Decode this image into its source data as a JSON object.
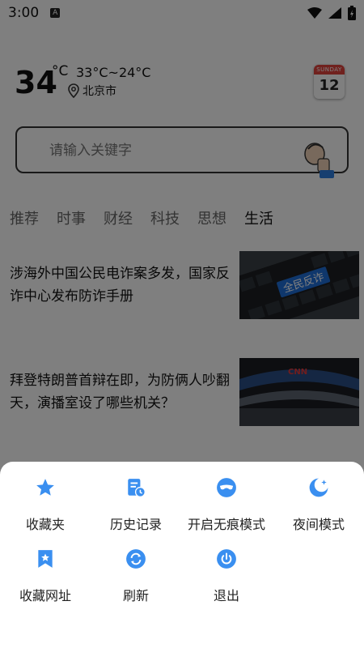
{
  "status_bar": {
    "time": "3:00",
    "badge": "A"
  },
  "weather": {
    "temperature": "34",
    "unit": "°C",
    "range": "33°C~24°C",
    "city": "北京市",
    "calendar_header": "SUNDAY",
    "calendar_day": "12"
  },
  "search": {
    "placeholder": "请输入关键字"
  },
  "tabs": [
    "推荐",
    "时事",
    "财经",
    "科技",
    "思想",
    "生活"
  ],
  "active_tab": "生活",
  "news": [
    {
      "title": "涉海外中国公民电诈案多发，国家反诈中心发布防诈手册",
      "thumb_text": "全民反诈"
    },
    {
      "title": "拜登特朗普首辩在即，为防俩人吵翻天，演播室设了哪些机关？",
      "thumb_text": "CNN"
    }
  ],
  "menu": {
    "accent_color": "#3a8ff0",
    "items": [
      {
        "label": "收藏夹",
        "icon": "star-icon"
      },
      {
        "label": "历史记录",
        "icon": "history-icon"
      },
      {
        "label": "开启无痕模式",
        "icon": "incognito-icon"
      },
      {
        "label": "夜间模式",
        "icon": "moon-icon"
      },
      {
        "label": "收藏网址",
        "icon": "bookmark-icon"
      },
      {
        "label": "刷新",
        "icon": "refresh-icon"
      },
      {
        "label": "退出",
        "icon": "power-icon"
      }
    ]
  }
}
